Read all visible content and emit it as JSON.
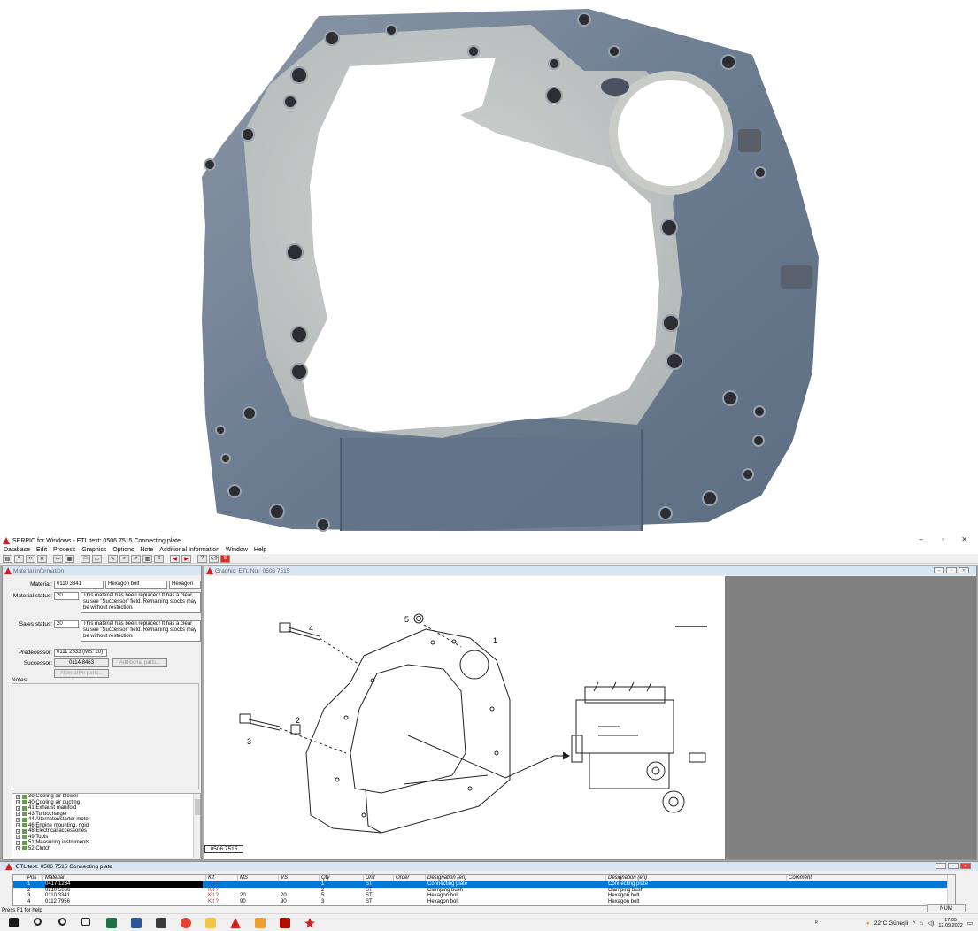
{
  "window": {
    "title": "SERPIC for Windows - ETL text: 0506 7515     Connecting plate",
    "controls": [
      "–",
      "▫",
      "✕"
    ]
  },
  "menu": [
    "Database",
    "Edit",
    "Process",
    "Graphics",
    "Options",
    "Note",
    "Additional Information",
    "Window",
    "Help"
  ],
  "material_window": {
    "title": "Material information",
    "material_label": "Material:",
    "material_value": "0110 3341",
    "material_desc1": "Hexagon bolt",
    "material_desc2": "Hexagon bo",
    "material_status_label": "Material status:",
    "material_status_code": "20",
    "material_status_text": "This material has been replaced! It has a clear su see \"Successor\" field. Remaining stocks may be without restriction.",
    "sales_status_label": "Sales status:",
    "sales_status_code": "20",
    "sales_status_text": "This material has been replaced! It has a clear su see \"Successor\" field. Remaining stocks may be without restriction.",
    "predecessor_label": "Predecessor:",
    "predecessor_value": "0111 2533 (MS: 20)",
    "successor_label": "Successor:",
    "successor_value": "0114 8463",
    "additional_parts_label": "Additional parts...",
    "alternative_parts_label": "Alternative parts...",
    "notes_label": "Notes:"
  },
  "tree": {
    "items": [
      "39 Cooling air blower",
      "40 Cooling air ducting",
      "41 Exhaust manifold",
      "43 Turbocharger",
      "44 Alternator/starter motor",
      "46 Engine mounting, rigid",
      "48 Electrical accessories",
      "49 Tools",
      "51 Measuring instruments",
      "52 Clutch"
    ]
  },
  "graphic_window": {
    "title": "Graphic: ETL No.: 0506 7515",
    "drawing_number": "0506 7515",
    "callouts": [
      "1",
      "2",
      "3",
      "4",
      "5"
    ]
  },
  "etl_window": {
    "title": "ETL text: 0506 7515     Connecting plate",
    "columns": [
      "Pos",
      "Material",
      "Kit",
      "MS",
      "VS",
      "Qty",
      "Unit",
      "Order",
      "Designation (en)",
      "Designation (en)",
      "Comment"
    ],
    "rows": [
      {
        "pos": "1",
        "material": "0417 1234",
        "kit": "Kit ?",
        "ms": "",
        "vs": "",
        "qty": "1",
        "unit": "ST",
        "order": "",
        "des1": "Connecting plate",
        "des2": "Connecting plate",
        "comment": ""
      },
      {
        "pos": "2",
        "material": "0210 5066",
        "kit": "Kit ?",
        "ms": "",
        "vs": "",
        "qty": "2",
        "unit": "ST",
        "order": "",
        "des1": "Clamping bush",
        "des2": "Clamping bush",
        "comment": ""
      },
      {
        "pos": "3",
        "material": "0110 3341",
        "kit": "Kit ?",
        "ms": "20",
        "vs": "20",
        "qty": "5",
        "unit": "ST",
        "order": "",
        "des1": "Hexagon bolt",
        "des2": "Hexagon bolt",
        "comment": ""
      },
      {
        "pos": "4",
        "material": "0112 7956",
        "kit": "Kit ?",
        "ms": "90",
        "vs": "90",
        "qty": "3",
        "unit": "ST",
        "order": "",
        "des1": "Hexagon bolt",
        "des2": "Hexagon bolt",
        "comment": ""
      }
    ]
  },
  "status": {
    "help": "Press F1 for help",
    "num": "NUM"
  },
  "taskbar": {
    "weather": "22°C  Güneşli",
    "time": "17:05",
    "date": "12.09.2022"
  },
  "colors": {
    "accent": "#0078d7",
    "child_title": "#d8e6f3",
    "kit_red": "#d42020",
    "plate": "#6f7f92"
  }
}
